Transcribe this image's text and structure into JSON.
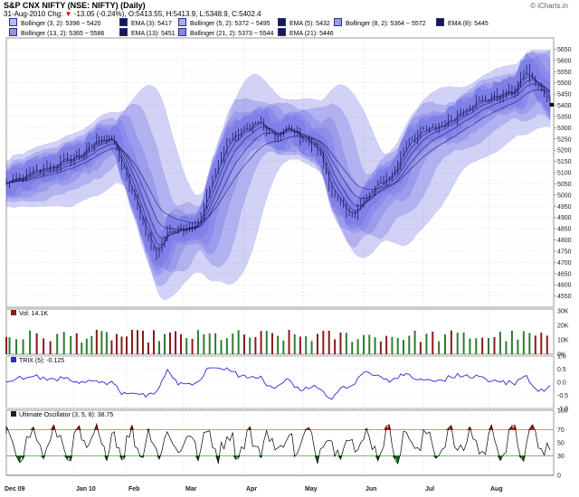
{
  "header": {
    "title": "S&P CNX NIFTY (NSE: NIFTY) (Daily)",
    "date": "31-Aug-2010",
    "change_label": "Chg:",
    "change": "-13.05 (-0.24%),",
    "ohlc": "O:5413.55, H:5413.9, L:5348.9, C:5402.4",
    "brand": "© iCharts.in"
  },
  "legend": [
    {
      "label": "Bollinger (3, 2): 5398 ~ 5420",
      "color": "#b8b8ee"
    },
    {
      "label": "EMA (3): 5417",
      "color": "#1a1a4a"
    },
    {
      "label": "Bollinger (5, 2): 5372 ~ 5495",
      "color": "#aaaae8"
    },
    {
      "label": "EMA (5): 5432",
      "color": "#1a1a4a"
    },
    {
      "label": "Bollinger (8, 2): 5364 ~ 5572",
      "color": "#9b9be6"
    },
    {
      "label": "EMA (8): 5445",
      "color": "#1a1a4a"
    },
    {
      "label": "Bollinger (13, 2): 5365 ~ 5586",
      "color": "#9393e0"
    },
    {
      "label": "EMA (13): 5451",
      "color": "#1a1a4a"
    },
    {
      "label": "Bollinger (21, 2): 5373 ~ 5544",
      "color": "#8888dc"
    },
    {
      "label": "EMA (21): 5446",
      "color": "#1a1a4a"
    }
  ],
  "panels": {
    "volume": {
      "label": "Vol: 14.1K"
    },
    "trix": {
      "label": "TRIX (5): -0.125"
    },
    "uo": {
      "label": "Ultimate Oscillator (3, 5, 8): 38.75"
    }
  },
  "colors": {
    "band": "#6a6ae6",
    "price": "#1a1a5e",
    "up": "#2e7d32",
    "down": "#8b1a1a",
    "trix": "#2b2bd6",
    "uo": "#000000",
    "uo_hi": "#cc0000",
    "uo_lo": "#006600",
    "ref": "#e06060"
  },
  "chart_data": [
    {
      "type": "line",
      "title": "S&P CNX NIFTY (NSE: NIFTY) (Daily)",
      "x_labels": [
        "Dec 09",
        "Jan 10",
        "Feb",
        "Mar",
        "Apr",
        "May",
        "Jun",
        "Jul",
        "Aug"
      ],
      "ylim": [
        4500,
        5700
      ],
      "yticks": [
        4550,
        4600,
        4650,
        4700,
        4750,
        4800,
        4850,
        4900,
        4950,
        5000,
        5050,
        5100,
        5150,
        5200,
        5250,
        5300,
        5350,
        5400,
        5450,
        5500,
        5550,
        5600,
        5650
      ],
      "grid": true,
      "anchors": [
        [
          "Dec 09",
          5050
        ],
        [
          "Dec 09",
          5130
        ],
        [
          "Jan 10",
          5200
        ],
        [
          "Jan 10",
          5260
        ],
        [
          "Jan 10",
          5240
        ],
        [
          "Feb",
          4900
        ],
        [
          "Feb",
          4730
        ],
        [
          "Feb",
          4850
        ],
        [
          "Mar",
          4870
        ],
        [
          "Mar",
          5100
        ],
        [
          "Mar",
          5250
        ],
        [
          "Apr",
          5330
        ],
        [
          "Apr",
          5250
        ],
        [
          "Apr",
          5300
        ],
        [
          "May",
          5200
        ],
        [
          "May",
          5000
        ],
        [
          "May",
          4900
        ],
        [
          "Jun",
          5050
        ],
        [
          "Jun",
          5100
        ],
        [
          "Jun",
          5250
        ],
        [
          "Jul",
          5320
        ],
        [
          "Jul",
          5400
        ],
        [
          "Aug",
          5450
        ],
        [
          "Aug",
          5460
        ],
        [
          "Aug",
          5560
        ],
        [
          "Aug",
          5402.4
        ]
      ],
      "last_close": 5402.4
    },
    {
      "type": "bar",
      "title": "Vol",
      "ylim": [
        0,
        30000
      ],
      "yticks": [
        "30K",
        "20K",
        "10K",
        "0K"
      ],
      "last": 14100
    },
    {
      "type": "line",
      "title": "TRIX (5)",
      "ylim": [
        -1.0,
        1.0
      ],
      "yticks": [
        1.0,
        0.5,
        0.0,
        -0.5,
        -1.0
      ],
      "last": -0.125
    },
    {
      "type": "line",
      "title": "Ultimate Oscillator (3, 5, 8)",
      "ylim": [
        0,
        100
      ],
      "yticks": [
        100,
        70,
        50,
        30,
        0
      ],
      "reference_lines": [
        70,
        30
      ],
      "last": 38.75
    }
  ]
}
